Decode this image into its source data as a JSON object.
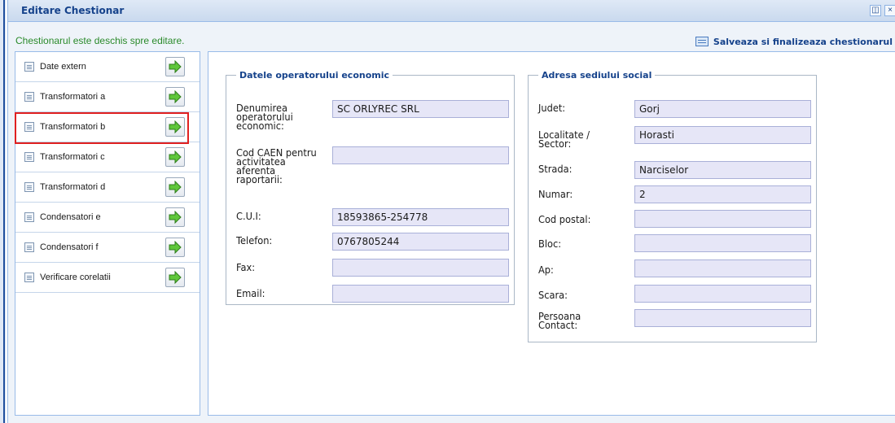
{
  "window": {
    "title": "Editare Chestionar",
    "restore_icon": "restore-icon",
    "close_icon": "close-icon",
    "status_text": "Chestionarul este deschis spre editare.",
    "save_label": "Salveaza si finalizeaza chestionarul"
  },
  "nav": {
    "items": [
      {
        "label": "Date extern"
      },
      {
        "label": "Transformatori a"
      },
      {
        "label": "Transformatori b",
        "highlighted": true
      },
      {
        "label": "Transformatori c"
      },
      {
        "label": "Transformatori d"
      },
      {
        "label": "Condensatori e"
      },
      {
        "label": "Condensatori f"
      },
      {
        "label": "Verificare corelatii"
      }
    ]
  },
  "operator": {
    "legend": "Datele operatorului economic",
    "fields": [
      {
        "label": "Denumirea operatorului economic:",
        "value": "SC ORLYREC SRL"
      },
      {
        "label": "Cod CAEN pentru activitatea aferenta raportarii:",
        "value": ""
      },
      {
        "label": "C.U.I:",
        "value": "18593865-254778"
      },
      {
        "label": "Telefon:",
        "value": "0767805244"
      },
      {
        "label": "Fax:",
        "value": ""
      },
      {
        "label": "Email:",
        "value": ""
      }
    ]
  },
  "address": {
    "legend": "Adresa sediului social",
    "fields": [
      {
        "label": "Judet:",
        "value": "Gorj"
      },
      {
        "label": "Localitate / Sector:",
        "value": "Horasti"
      },
      {
        "label": "Strada:",
        "value": "Narciselor"
      },
      {
        "label": "Numar:",
        "value": "2"
      },
      {
        "label": "Cod postal:",
        "value": ""
      },
      {
        "label": "Bloc:",
        "value": ""
      },
      {
        "label": "Ap:",
        "value": ""
      },
      {
        "label": "Scara:",
        "value": ""
      },
      {
        "label": "Persoana Contact:",
        "value": ""
      }
    ]
  },
  "colors": {
    "accent": "#15428b",
    "status_green": "#2a8a2a",
    "highlight_red": "#e02020",
    "input_bg": "#e6e6f7"
  }
}
